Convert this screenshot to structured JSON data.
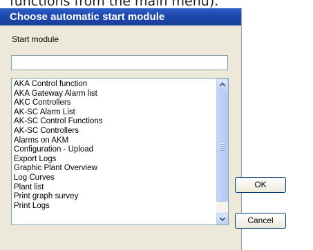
{
  "background_text": "functions from the main menu).",
  "dialog": {
    "title": "Choose automatic start module",
    "label": "Start module",
    "input_value": "",
    "items": [
      "AKA Control function",
      "AKA Gateway Alarm list",
      "AKC Controllers",
      "AK-SC Alarm List",
      "AK-SC Control Functions",
      "AK-SC Controllers",
      "Alarms on AKM",
      "Configuration - Upload",
      "Export Logs",
      "Graphic Plant Overview",
      "Log Curves",
      "Plant list",
      "Print graph survey",
      "Print Logs"
    ],
    "ok_label": "OK",
    "cancel_label": "Cancel"
  },
  "colors": {
    "title_bar": "#1f49b0",
    "dialog_bg": "#ece9d8",
    "input_border": "#7f9db9"
  }
}
